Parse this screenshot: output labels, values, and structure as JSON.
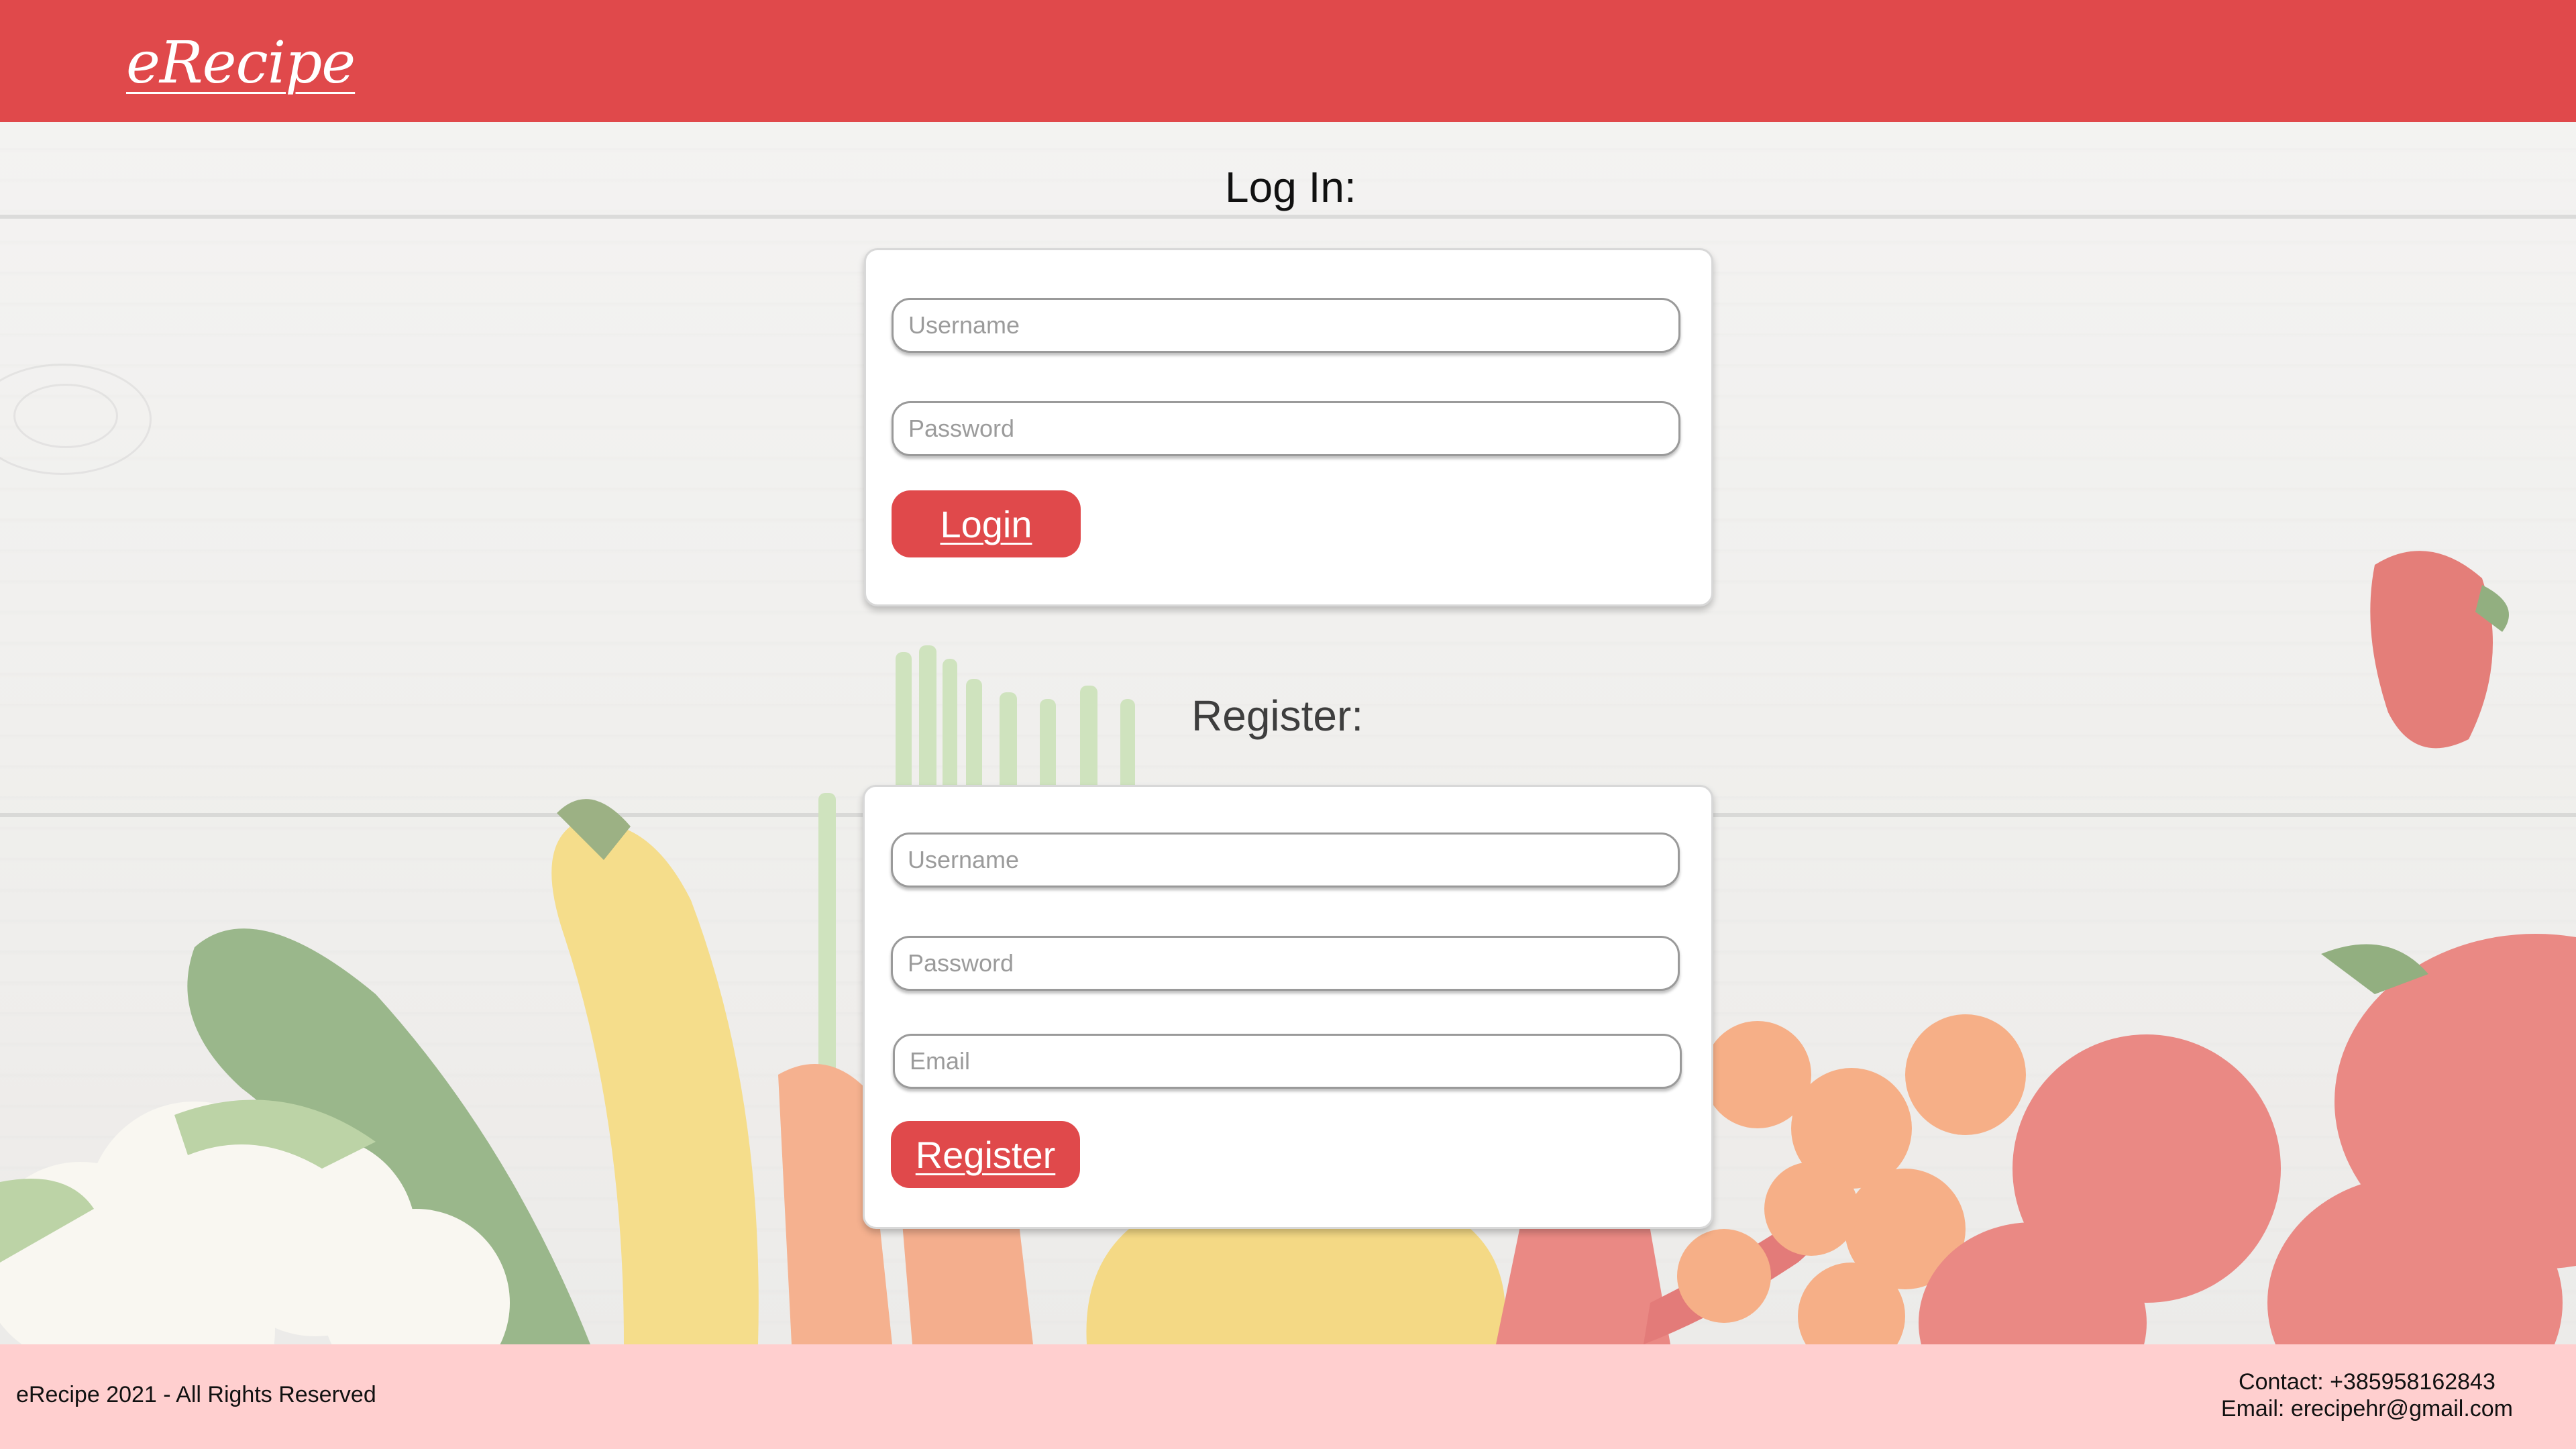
{
  "header": {
    "logo": "eRecipe"
  },
  "login": {
    "title": "Log In:",
    "username_placeholder": "Username",
    "password_placeholder": "Password",
    "button_label": "Login"
  },
  "register": {
    "title": "Register:",
    "username_placeholder": "Username",
    "password_placeholder": "Password",
    "email_placeholder": "Email",
    "button_label": "Register"
  },
  "footer": {
    "copyright": "eRecipe 2021 - All Rights Reserved",
    "contact_phone": "Contact: +385958162843",
    "contact_email": "Email: erecipehr@gmail.com"
  },
  "colors": {
    "brand": "#e0494b",
    "footer_bg": "#ffcfcf",
    "card_bg": "#ffffff"
  }
}
